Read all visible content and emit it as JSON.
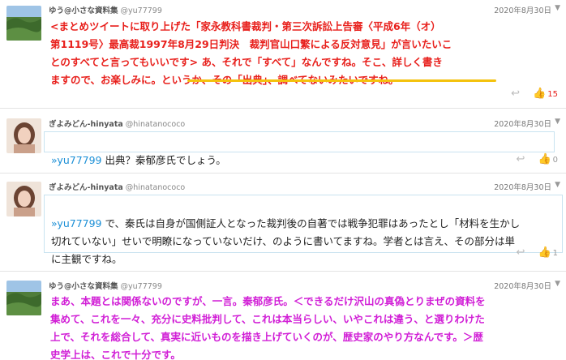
{
  "tweets": [
    {
      "user_name": "ゆう@小さな資料集",
      "handle": "@yu77799",
      "date": "2020年8月30日",
      "text": "<まとめツイートに取り上げた「家永教科書裁判・第三次訴訟上告審〈平成6年（オ）\n第1119号〉最高裁1997年8月29日判決　裁判官山口繁による反対意見」が言いたいこ\nとのすべてと言ってもいいです> あ、それで「すべて」なんですね。そこ、詳しく書き\nますので、お楽しみに。というか、その「出典」、調べてないみたいですね。",
      "like_count": "15"
    },
    {
      "user_name": "ぎよみどん-hinyata",
      "handle": "@hinatanococo",
      "date": "2020年8月30日",
      "mention": "»yu77799",
      "text": " 出典？秦郁彦氏でしょう。",
      "like_count": "0"
    },
    {
      "user_name": "ぎよみどん-hinyata",
      "handle": "@hinatanococo",
      "date": "2020年8月30日",
      "mention": "»yu77799",
      "text": " で、秦氏は自身が国側証人となった裁判後の自著では戦争犯罪はあったとし「材料を生かし\n切れていない」せいで明瞭になっていないだけ、のように書いてますね。学者とは言え、その部分は単\nに主観ですね。",
      "like_count": "1"
    },
    {
      "user_name": "ゆう@小さな資料集",
      "handle": "@yu77799",
      "date": "2020年8月30日",
      "text": "まあ、本題とは関係ないのですが、一言。秦郁彦氏。＜できるだけ沢山の真偽とりまぜの資料を\n集めて、これを一々、充分に史料批判して、これは本当らしい、いやこれは違う、と選りわけた\n上で、それを総合して、真実に近いものを描き上げていくのが、歴史家のやり方なんです。＞歴\n史学上は、これで十分です。"
    }
  ],
  "icons": {
    "chevron": "chevron-down-icon",
    "reply": "reply-icon",
    "like": "like-thumb-icon"
  },
  "colors": {
    "red_text": "#e8201c",
    "magenta_text": "#d11fd6",
    "mention": "#1b8fd6",
    "underline": "#f4c20d"
  }
}
